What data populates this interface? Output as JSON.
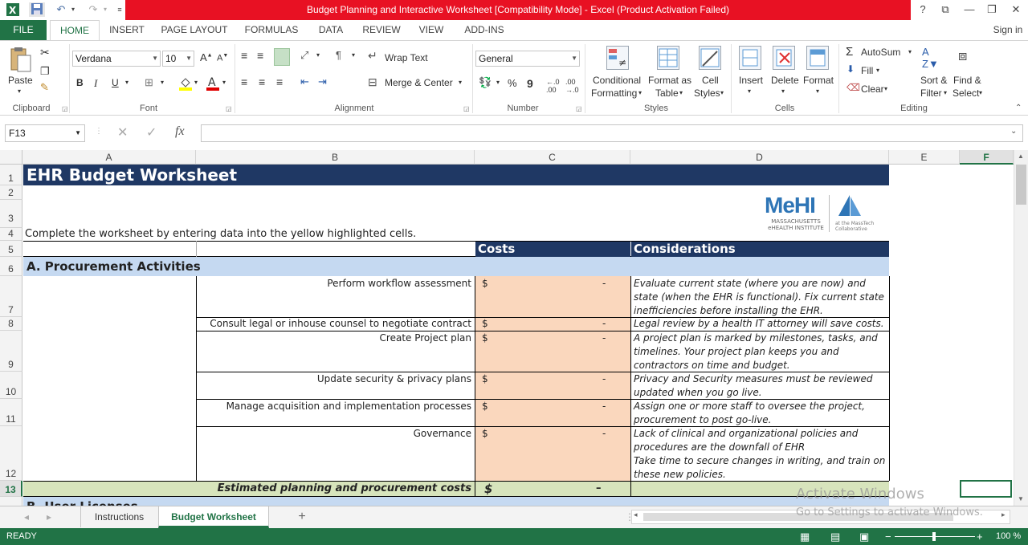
{
  "titlebar": {
    "title": "Budget Planning and Interactive Worksheet  [Compatibility Mode] -  Excel (Product Activation Failed)",
    "help": "?",
    "ribbon_display": "⧉",
    "minimize": "—",
    "restore": "❐",
    "close": "✕"
  },
  "tabs": {
    "file": "FILE",
    "home": "HOME",
    "insert": "INSERT",
    "page_layout": "PAGE LAYOUT",
    "formulas": "FORMULAS",
    "data": "DATA",
    "review": "REVIEW",
    "view": "VIEW",
    "addins": "ADD-INS",
    "signin": "Sign in"
  },
  "ribbon": {
    "clipboard": {
      "label": "Clipboard",
      "paste": "Paste"
    },
    "font": {
      "label": "Font",
      "name": "Verdana",
      "size": "10",
      "bold": "B",
      "italic": "I",
      "underline": "U"
    },
    "alignment": {
      "label": "Alignment",
      "wrap_text": "Wrap Text",
      "merge_center": "Merge & Center"
    },
    "number": {
      "label": "Number",
      "format": "General",
      "percent": "%",
      "comma": "9"
    },
    "styles": {
      "label": "Styles",
      "conditional_1": "Conditional",
      "conditional_2": "Formatting",
      "format_table_1": "Format as",
      "format_table_2": "Table",
      "cell_styles_1": "Cell",
      "cell_styles_2": "Styles"
    },
    "cells": {
      "label": "Cells",
      "insert": "Insert",
      "delete": "Delete",
      "format": "Format"
    },
    "editing": {
      "label": "Editing",
      "autosum": "AutoSum",
      "fill": "Fill",
      "clear": "Clear",
      "sort_1": "Sort &",
      "sort_2": "Filter",
      "find_1": "Find &",
      "find_2": "Select"
    }
  },
  "formula_bar": {
    "name_box": "F13",
    "fx": "fx",
    "value": ""
  },
  "columns": [
    "A",
    "B",
    "C",
    "D",
    "E",
    "F"
  ],
  "rows": [
    "1",
    "2",
    "3",
    "4",
    "5",
    "6",
    "7",
    "8",
    "9",
    "10",
    "11",
    "12",
    "13"
  ],
  "sheet": {
    "title": "EHR Budget Worksheet",
    "instruction": "Complete the worksheet by entering data into the yellow highlighted cells.",
    "logo_text": "MeHI",
    "logo_sub_1": "MASSACHUSETTS",
    "logo_sub_2": "eHEALTH INSTITUTE",
    "logo_side_1": "at the MassTech",
    "logo_side_2": "Collaborative",
    "costs_header": "Costs",
    "considerations_header": "Considerations",
    "section_a": "A. Procurement Activities",
    "section_b_partial": "B. User Licenses",
    "items": [
      {
        "activity": "Perform workflow assessment",
        "cost_symbol": "$",
        "cost_value": "-",
        "consideration": [
          "Evaluate current state (where you are now) and future",
          "state (when the EHR is functional). Fix current state",
          "inefficiencies before installing the EHR."
        ]
      },
      {
        "activity": "Consult legal or inhouse counsel to negotiate contract",
        "cost_symbol": "$",
        "cost_value": "-",
        "consideration": [
          "Legal review by a health IT attorney will save costs."
        ]
      },
      {
        "activity": "Create Project plan",
        "cost_symbol": "$",
        "cost_value": "-",
        "consideration": [
          "A project plan is marked by milestones, tasks, and",
          "timelines. Your project plan keeps you and",
          "contractors on time and budget."
        ]
      },
      {
        "activity": "Update security & privacy plans",
        "cost_symbol": "$",
        "cost_value": "-",
        "consideration": [
          "Privacy and Security measures must be reviewed and",
          "updated when you go live."
        ]
      },
      {
        "activity": "Manage acquisition and implementation processes",
        "cost_symbol": "$",
        "cost_value": "-",
        "consideration": [
          "Assign one or more staff to oversee the project,  from",
          "procurement to post go-live."
        ]
      },
      {
        "activity": "Governance",
        "cost_symbol": "$",
        "cost_value": "-",
        "consideration": [
          "Lack of clinical and organizational policies and",
          "procedures are the downfall of EHR implementations.",
          "Take time to secure changes in writing, and train on",
          "these new policies."
        ]
      }
    ],
    "total_label": "Estimated planning and procurement costs",
    "total_symbol": "$",
    "total_value": "–"
  },
  "sheet_tabs": {
    "instructions": "Instructions",
    "budget": "Budget Worksheet",
    "add": "+"
  },
  "status": {
    "ready": "READY",
    "zoom": "100 %"
  },
  "watermark": {
    "line1": "Activate Windows",
    "line2": "Go to Settings to activate Windows."
  },
  "colors": {
    "excel_green": "#217346",
    "title_red": "#e81123",
    "navy": "#1f3864",
    "light_blue": "#c5d9f1",
    "peach": "#fad7bd",
    "total_green": "#d7e4bc"
  }
}
